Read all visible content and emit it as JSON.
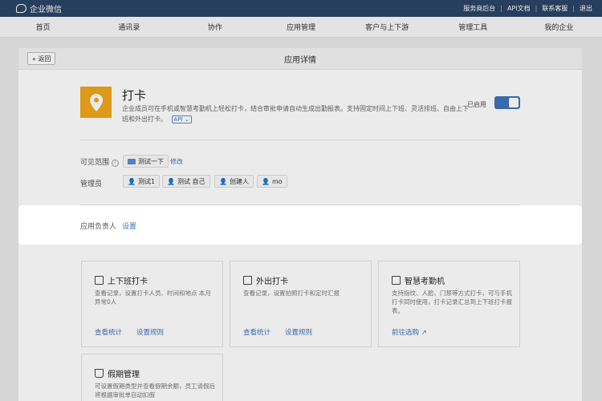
{
  "topbar": {
    "brand": "企业微信",
    "links": [
      "服务商后台",
      "API文档",
      "联系客服",
      "退出"
    ]
  },
  "nav": [
    "首页",
    "通讯录",
    "协作",
    "应用管理",
    "客户与上下游",
    "管理工具",
    "我的企业"
  ],
  "panel": {
    "back_label": "« 返回",
    "title": "应用详情"
  },
  "app": {
    "name": "打卡",
    "desc": "企业成员可在手机或智慧考勤机上轻松打卡，结合审批申请自动生成出勤报表。支持固定时间上下班、灵活排班、自由上下班和外出打卡。",
    "api_label": "API",
    "status": "已启用",
    "enabled": true
  },
  "visibility": {
    "label": "可见范围",
    "scope": "测试一下",
    "edit": "修改"
  },
  "admins": {
    "label": "管理员",
    "items": [
      "测试1",
      "测试 自己",
      "创建人",
      "mo"
    ]
  },
  "owner": {
    "label": "应用负责人",
    "action": "设置"
  },
  "cards": [
    {
      "title": "上下班打卡",
      "icon": "clipboard-icon",
      "desc": "查看记录，设置打卡人员、时间和地点 本月异常0人",
      "links": [
        "查看统计",
        "设置规则"
      ]
    },
    {
      "title": "外出打卡",
      "icon": "briefcase-icon",
      "desc": "查看记录，设置拍照打卡和定时汇报",
      "links": [
        "查看统计",
        "设置规则"
      ]
    },
    {
      "title": "智慧考勤机",
      "icon": "device-icon",
      "desc": "支持指纹、人脸、门禁等方式打卡，可与手机打卡同时使用，打卡记录汇总到上下班打卡报表。",
      "links": [
        "前往选购"
      ]
    },
    {
      "title": "假期管理",
      "icon": "cup-icon",
      "desc": "可设置假期类型并查看假期余额，员工请假后将根据审批单自动扣假",
      "links": []
    }
  ],
  "colors": {
    "topbar": "#2c4466",
    "accent": "#3f72b8",
    "app_logo": "#f0a71a"
  }
}
